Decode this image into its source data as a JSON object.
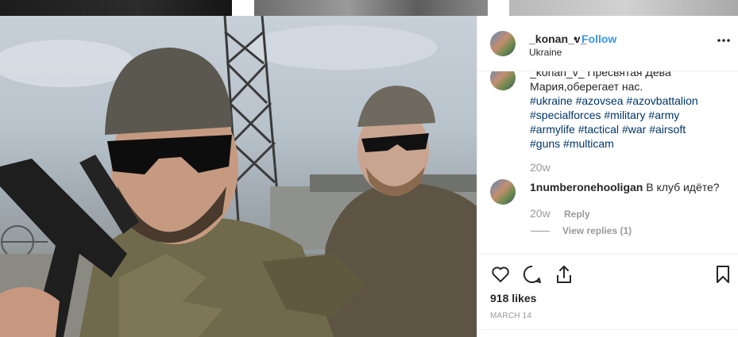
{
  "post": {
    "username": "_konan_v_",
    "separator": "•",
    "follow_label": "Follow",
    "location": "Ukraine",
    "more_icon": "more-horizontal-icon"
  },
  "caption": {
    "partial_first_line": "_konan_v_ Пресвятая Дева",
    "text": "Мария,оберегает нас.",
    "hashtags": [
      "#ukraine",
      "#azovsea",
      "#azovbattalion",
      "#specialforces",
      "#military",
      "#army",
      "#armylife",
      "#tactical",
      "#war",
      "#airsoft",
      "#guns",
      "#multicam"
    ],
    "time": "20w"
  },
  "comments": [
    {
      "username": "1numberonehooligan",
      "text": "В клуб идёте?",
      "time": "20w",
      "reply_label": "Reply",
      "view_replies_label": "View replies (1)"
    }
  ],
  "actions": {
    "like_icon": "heart-icon",
    "comment_icon": "comment-icon",
    "share_icon": "share-icon",
    "save_icon": "bookmark-icon"
  },
  "likes_label": "918 likes",
  "date_label": "MARCH 14"
}
